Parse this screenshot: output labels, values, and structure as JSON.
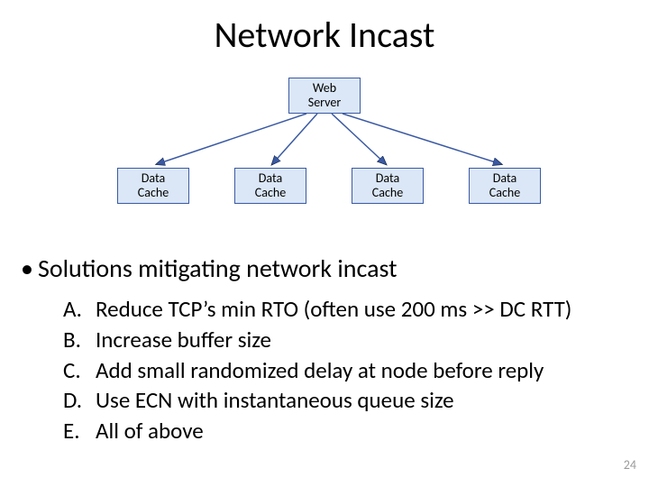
{
  "title": "Network Incast",
  "diagram": {
    "web_server": "Web\nServer",
    "data_caches": [
      "Data\nCache",
      "Data\nCache",
      "Data\nCache",
      "Data\nCache"
    ]
  },
  "bullet": "Solutions mitigating network incast",
  "options": [
    {
      "letter": "A.",
      "text": "Reduce TCP’s min RTO (often use 200 ms >> DC RTT)"
    },
    {
      "letter": "B.",
      "text": "Increase buffer size"
    },
    {
      "letter": "C.",
      "text": "Add small randomized delay at node before reply"
    },
    {
      "letter": "D.",
      "text": "Use ECN with instantaneous queue size"
    },
    {
      "letter": "E.",
      "text": "All of above"
    }
  ],
  "page_number": "24"
}
